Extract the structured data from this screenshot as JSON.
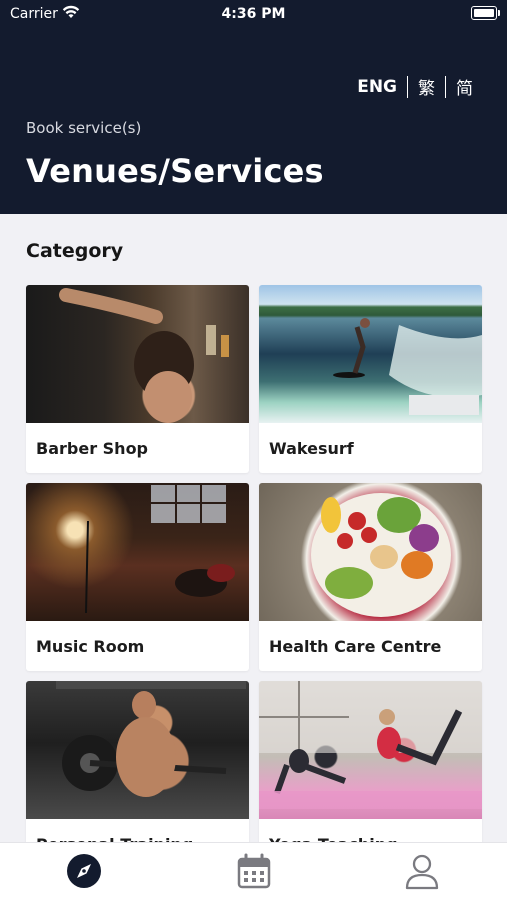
{
  "status_bar": {
    "carrier": "Carrier",
    "time": "4:36 PM"
  },
  "header": {
    "languages": [
      {
        "label": "ENG",
        "active": true
      },
      {
        "label": "繁",
        "active": false
      },
      {
        "label": "简",
        "active": false
      }
    ],
    "subtitle": "Book service(s)",
    "title": "Venues/Services"
  },
  "main": {
    "section_title": "Category",
    "categories": [
      {
        "label": "Barber Shop",
        "image": "barber-photo"
      },
      {
        "label": "Wakesurf",
        "image": "wakesurf-photo"
      },
      {
        "label": "Music Room",
        "image": "music-room-photo"
      },
      {
        "label": "Health Care Centre",
        "image": "salad-bowl-photo"
      },
      {
        "label": "Personal Training",
        "image": "trainer-photo"
      },
      {
        "label": "Yoga Teaching",
        "image": "yoga-photo"
      }
    ]
  },
  "tabbar": {
    "tabs": [
      {
        "name": "explore",
        "icon": "compass-icon",
        "active": true
      },
      {
        "name": "bookings",
        "icon": "calendar-icon",
        "active": false
      },
      {
        "name": "profile",
        "icon": "user-icon",
        "active": false
      }
    ]
  },
  "colors": {
    "header_bg": "#131b2e",
    "page_bg": "#f1f1f5",
    "icon_active": "#131b2e",
    "icon_inactive": "#7a7a80"
  }
}
